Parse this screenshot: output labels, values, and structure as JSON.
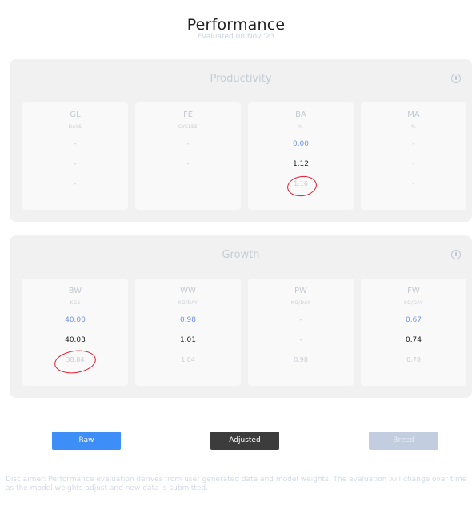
{
  "header": {
    "title": "Performance",
    "subtitle": "Evaluated 08 Nov '23"
  },
  "productivity": {
    "title": "Productivity",
    "metrics": [
      {
        "title": "GL",
        "unit": "DAYS",
        "v1": "-",
        "v2": "-",
        "v3": "-"
      },
      {
        "title": "FE",
        "unit": "CYCLES",
        "v1": "-",
        "v2": "-",
        "v3": ""
      },
      {
        "title": "BA",
        "unit": "%",
        "v1": "0.00",
        "v2": "1.12",
        "v3": "1.16"
      },
      {
        "title": "MA",
        "unit": "%",
        "v1": "-",
        "v2": "-",
        "v3": "-"
      }
    ]
  },
  "growth": {
    "title": "Growth",
    "metrics": [
      {
        "title": "BW",
        "unit": "KGS",
        "v1": "40.00",
        "v2": "40.03",
        "v3": "38.84"
      },
      {
        "title": "WW",
        "unit": "KG/DAY",
        "v1": "0.98",
        "v2": "1.01",
        "v3": "1.04"
      },
      {
        "title": "PW",
        "unit": "KG/DAY",
        "v1": "-",
        "v2": "-",
        "v3": "0.98"
      },
      {
        "title": "FW",
        "unit": "KG/DAY",
        "v1": "0.67",
        "v2": "0.74",
        "v3": "0.78"
      }
    ]
  },
  "buttons": {
    "raw": "Raw",
    "adjusted": "Adjusted",
    "breed": "Breed"
  },
  "disclaimer": "Disclaimer: Performance evaluation derives from user generated data and model weights. The evaluation will change over time as the model weights adjust and new data is submitted.",
  "colors": {
    "accent": "#3d8ef7",
    "adjusted": "#3c3c3c",
    "breed_disabled": "#c2cedf",
    "raw_value": "#6f95e8",
    "annotation": "#e41a2c"
  }
}
